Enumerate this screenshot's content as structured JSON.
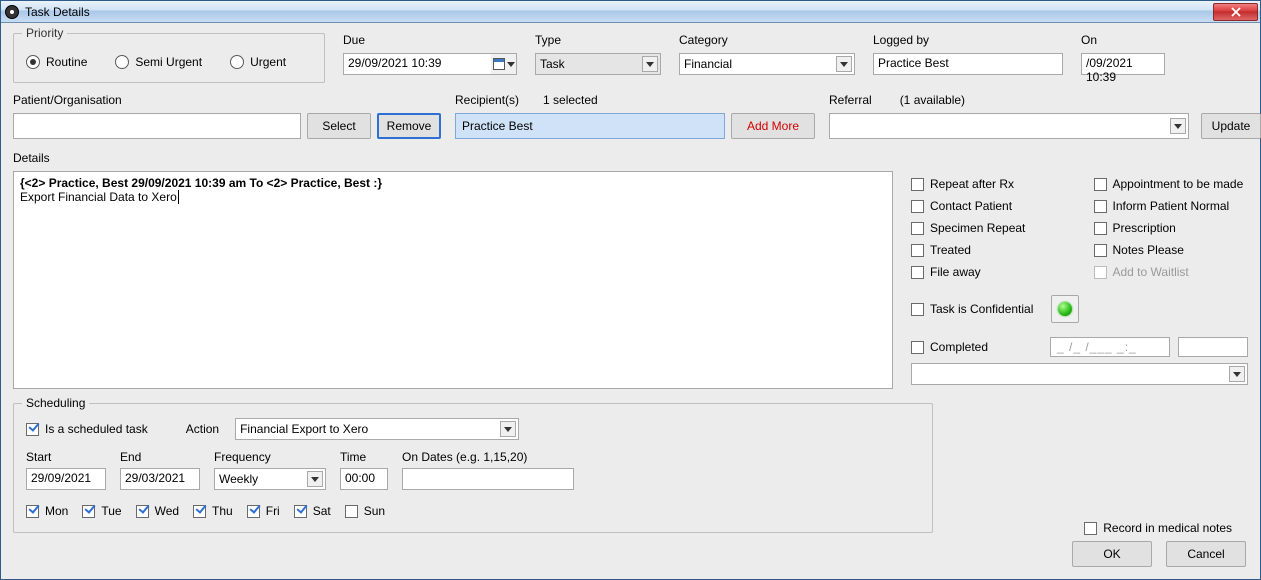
{
  "window": {
    "title": "Task Details"
  },
  "priority": {
    "legend": "Priority",
    "options": {
      "routine": "Routine",
      "semi": "Semi Urgent",
      "urgent": "Urgent"
    },
    "selected": "routine"
  },
  "top": {
    "due": {
      "label": "Due",
      "value": "29/09/2021 10:39"
    },
    "type": {
      "label": "Type",
      "value": "Task"
    },
    "category": {
      "label": "Category",
      "value": "Financial"
    },
    "logged_by": {
      "label": "Logged by",
      "value": "Practice Best"
    },
    "on": {
      "label": "On",
      "value": "/09/2021 10:39"
    }
  },
  "patient_org": {
    "label": "Patient/Organisation",
    "value": ""
  },
  "buttons": {
    "select": "Select",
    "remove": "Remove",
    "add_more": "Add More",
    "update": "Update",
    "ok": "OK",
    "cancel": "Cancel"
  },
  "recipients": {
    "label": "Recipient(s)",
    "count_text": "1 selected",
    "value": "Practice Best"
  },
  "referral": {
    "label": "Referral",
    "hint": "(1 available)",
    "value": ""
  },
  "details": {
    "label": "Details",
    "line1": "{<2> Practice, Best 29/09/2021 10:39 am To <2> Practice, Best :}",
    "line2": "Export Financial Data to Xero"
  },
  "flags": {
    "repeat_after_rx": "Repeat after Rx",
    "appointment": "Appointment to be made",
    "contact_patient": "Contact Patient",
    "inform_patient_normal": "Inform Patient Normal",
    "specimen_repeat": "Specimen Repeat",
    "prescription": "Prescription",
    "treated": "Treated",
    "notes_please": "Notes Please",
    "file_away": "File away",
    "add_waitlist": "Add to Waitlist",
    "confidential": "Task is Confidential",
    "completed": "Completed",
    "completed_date_placeholder": "_ /_ /___ _:_"
  },
  "sched": {
    "legend": "Scheduling",
    "is_scheduled": "Is a scheduled task",
    "action_label": "Action",
    "action_value": "Financial Export to Xero",
    "start_label": "Start",
    "start_value": "29/09/2021",
    "end_label": "End",
    "end_value": "29/03/2021",
    "freq_label": "Frequency",
    "freq_value": "Weekly",
    "time_label": "Time",
    "time_value": "00:00",
    "ondates_label": "On Dates (e.g. 1,15,20)",
    "ondates_value": "",
    "dow": {
      "mon": "Mon",
      "tue": "Tue",
      "wed": "Wed",
      "thu": "Thu",
      "fri": "Fri",
      "sat": "Sat",
      "sun": "Sun"
    }
  },
  "record_notes": "Record in medical notes"
}
